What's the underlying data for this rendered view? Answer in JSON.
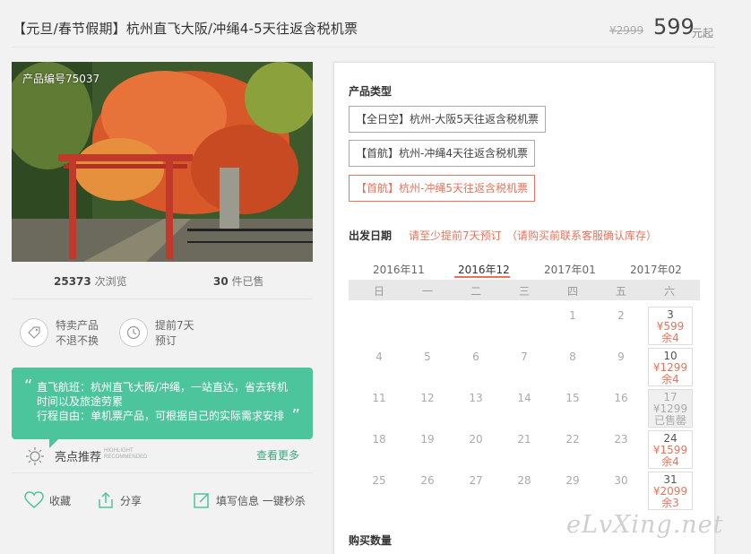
{
  "header": {
    "title": "【元旦/春节假期】杭州直飞大阪/冲绳4-5天往返含税机票",
    "old_price": "¥2999",
    "price": "599",
    "price_unit": "元起"
  },
  "photo": {
    "code_label": "产品编号75037"
  },
  "stats": {
    "views_num": "25373",
    "views_unit": "次浏览",
    "sold_num": "30",
    "sold_unit": "件已售"
  },
  "features": [
    {
      "line1": "特卖产品",
      "line2": "不退不换",
      "icon": "tag-icon"
    },
    {
      "line1": "提前7天",
      "line2": "预订",
      "icon": "clock-icon"
    }
  ],
  "highlight_box": {
    "line1": "直飞航班：杭州直飞大阪/冲绳，一站直达，省去转机",
    "line2": "时间以及旅途劳累",
    "line3": "行程自由：单机票产品，可根据自己的实际需求安排"
  },
  "highlight": {
    "label": "亮点推荐",
    "en1": "HIGHLIGHT",
    "en2": "RECOMMENDED",
    "more": "查看更多"
  },
  "actions": {
    "favorite": "收藏",
    "share": "分享",
    "fill_info": "填写信息 一键秒杀"
  },
  "panel": {
    "product_type_label": "产品类型",
    "product_types": [
      "【全日空】杭州-大阪5天往返含税机票",
      "【首航】杭州-冲绳4天往返含税机票",
      "【首航】杭州-冲绳5天往返含税机票"
    ],
    "date_label": "出发日期",
    "date_note1": "请至少提前7天预订",
    "date_note2": "（请购买前联系客服确认库存）",
    "months": [
      "2016年11",
      "2016年12",
      "2017年01",
      "2017年02"
    ],
    "weekdays": [
      "日",
      "一",
      "二",
      "三",
      "四",
      "五",
      "六"
    ],
    "days": [
      "1",
      "2",
      "4",
      "5",
      "6",
      "7",
      "8",
      "9",
      "11",
      "12",
      "13",
      "14",
      "15",
      "16",
      "18",
      "19",
      "20",
      "21",
      "22",
      "23",
      "25",
      "26",
      "27",
      "28",
      "29",
      "30"
    ],
    "priced_days": [
      {
        "day": "3",
        "price": "¥599",
        "remain": "余4"
      },
      {
        "day": "10",
        "price": "¥1299",
        "remain": "余4"
      },
      {
        "day": "17",
        "price": "¥1299",
        "remain": "已售罄"
      },
      {
        "day": "24",
        "price": "¥1599",
        "remain": "余4"
      },
      {
        "day": "31",
        "price": "¥2099",
        "remain": "余3"
      }
    ],
    "qty_label": "购买数量"
  },
  "watermark": "eLvXing.net",
  "colors": {
    "accent": "#e8735a",
    "green": "#4dc59c"
  }
}
